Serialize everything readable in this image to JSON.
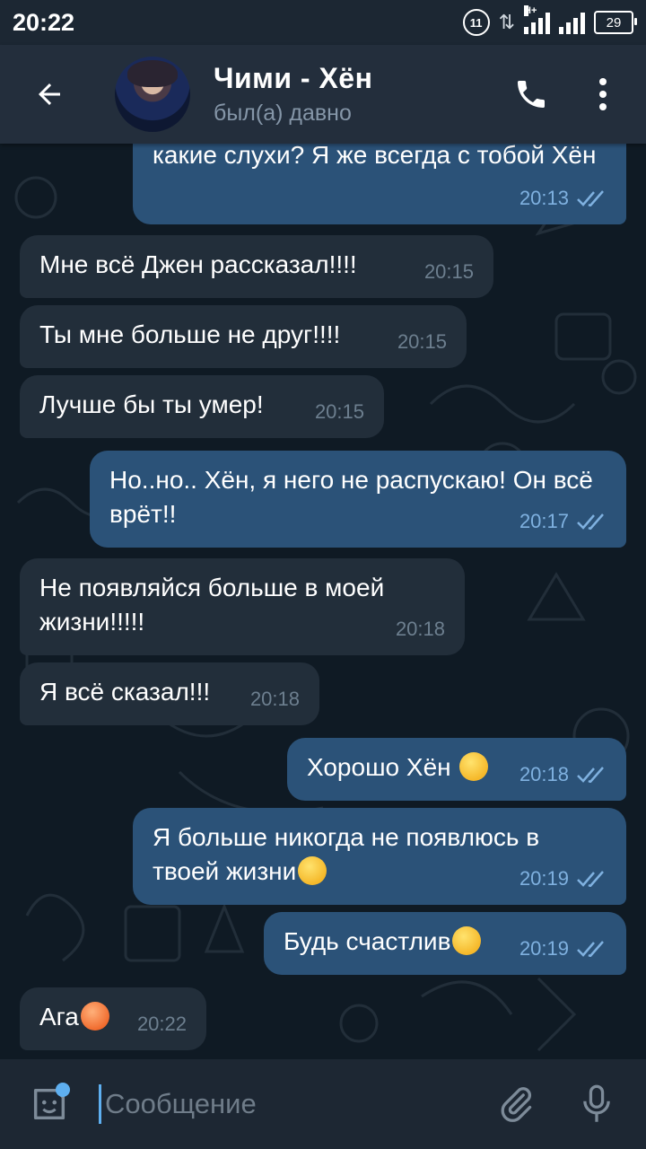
{
  "status_bar": {
    "time": "20:22",
    "network_badge": "11",
    "data_arrows": "⇅",
    "signal_label": "H+",
    "battery": "29"
  },
  "header": {
    "title": "Чими - Хён",
    "status": "был(а) давно",
    "back_icon": "arrow-left-icon",
    "call_icon": "phone-icon",
    "menu_icon": "more-vertical-icon"
  },
  "messages": [
    {
      "dir": "out",
      "text": "какие слухи? Я же всегда с тобой Хён",
      "time": "20:13",
      "read": true
    },
    {
      "dir": "in",
      "text": "Мне всё Джен рассказал!!!!",
      "time": "20:15"
    },
    {
      "dir": "in",
      "text": "Ты мне больше не друг!!!!",
      "time": "20:15"
    },
    {
      "dir": "in",
      "text": "Лучше бы ты умер!",
      "time": "20:15"
    },
    {
      "dir": "out",
      "text": "Но..но.. Хён, я него не распускаю! Он всё врёт!!",
      "time": "20:17",
      "read": true
    },
    {
      "dir": "in",
      "text": "Не появляйся больше в моей жизни!!!!!",
      "time": "20:18"
    },
    {
      "dir": "in",
      "text": "Я всё сказал!!!",
      "time": "20:18"
    },
    {
      "dir": "out",
      "text": "Хорошо Хён",
      "emoji": "pensive-face",
      "time": "20:18",
      "read": true
    },
    {
      "dir": "out",
      "text": "Я больше никогда не появлюсь в твоей жизни",
      "emoji": "disappointed-face",
      "time": "20:19",
      "read": true
    },
    {
      "dir": "out",
      "text": "Будь счастлив",
      "emoji": "smiling-face",
      "time": "20:19",
      "read": true
    },
    {
      "dir": "in",
      "text": "Ага",
      "emoji": "angry-face",
      "time": "20:22"
    }
  ],
  "composer": {
    "placeholder": "Сообщение",
    "sticker_icon": "sticker-icon",
    "attach_icon": "paperclip-icon",
    "mic_icon": "microphone-icon"
  },
  "colors": {
    "header_bg": "#232e3c",
    "chat_bg": "#0f1a24",
    "incoming_bubble": "#222e3a",
    "outgoing_bubble": "#2b5278",
    "accent": "#5eaff0"
  }
}
